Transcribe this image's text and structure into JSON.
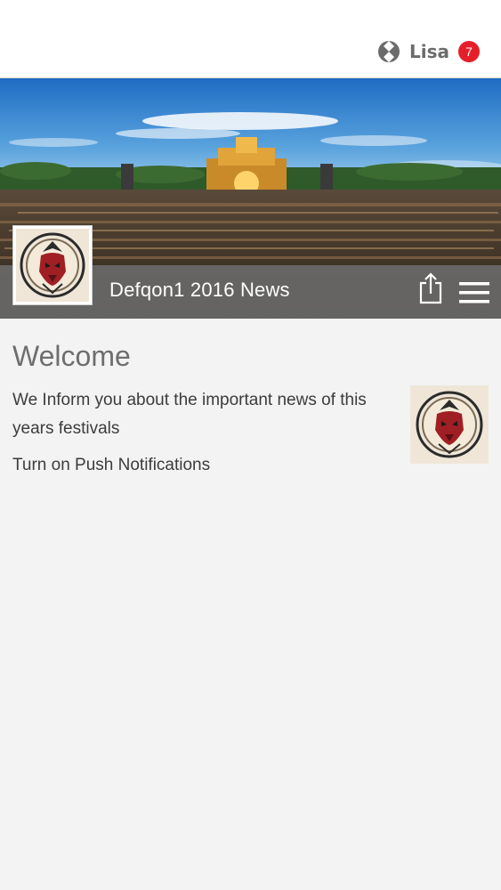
{
  "header": {
    "user_name": "Lisa",
    "notification_count": "7",
    "badge_color": "#e51f2a"
  },
  "channel": {
    "title": "Defqon1 2016 News"
  },
  "icons": {
    "top_logo": "app-logo-icon",
    "share": "share-icon",
    "menu": "hamburger-menu-icon"
  },
  "content": {
    "heading": "Welcome",
    "description": "We Inform you about the important news of this years festivals",
    "push_link": "Turn on Push Notifications"
  }
}
